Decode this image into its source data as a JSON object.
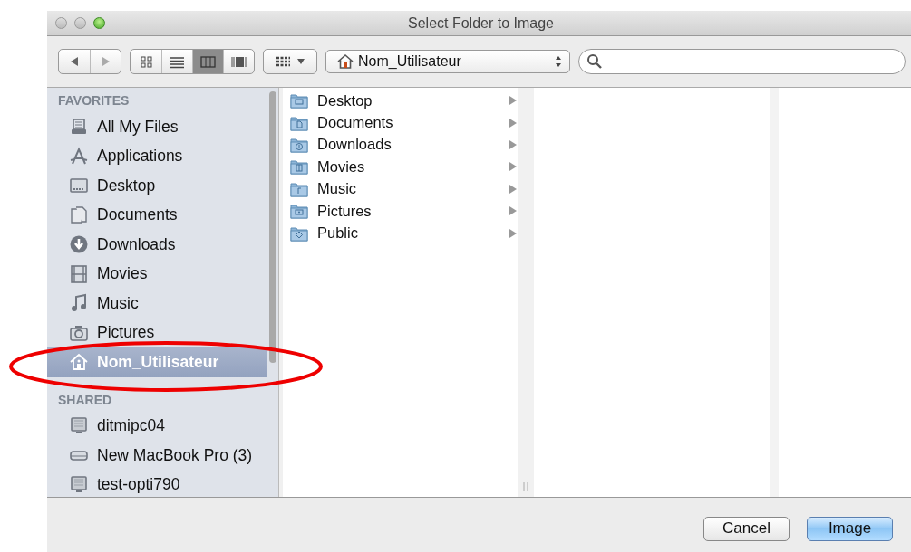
{
  "window": {
    "title": "Select Folder to Image"
  },
  "toolbar": {
    "view_modes": [
      {
        "selected": false
      },
      {
        "selected": false
      },
      {
        "selected": true
      },
      {
        "selected": false
      }
    ],
    "path": "Nom_Utilisateur"
  },
  "sidebar": {
    "sections": [
      {
        "heading": "FAVORITES",
        "items": [
          {
            "label": "All My Files",
            "selected": false
          },
          {
            "label": "Applications",
            "selected": false
          },
          {
            "label": "Desktop",
            "selected": false
          },
          {
            "label": "Documents",
            "selected": false
          },
          {
            "label": "Downloads",
            "selected": false
          },
          {
            "label": "Movies",
            "selected": false
          },
          {
            "label": "Music",
            "selected": false
          },
          {
            "label": "Pictures",
            "selected": false
          },
          {
            "label": "Nom_Utilisateur",
            "selected": true
          }
        ]
      },
      {
        "heading": "SHARED",
        "items": [
          {
            "label": "ditmipc04",
            "selected": false
          },
          {
            "label": "New MacBook Pro (3)",
            "selected": false
          },
          {
            "label": "test-opti790",
            "selected": false
          }
        ]
      }
    ]
  },
  "column_1": {
    "items": [
      {
        "label": "Desktop"
      },
      {
        "label": "Documents"
      },
      {
        "label": "Downloads"
      },
      {
        "label": "Movies"
      },
      {
        "label": "Music"
      },
      {
        "label": "Pictures"
      },
      {
        "label": "Public"
      }
    ]
  },
  "buttons": [
    {
      "label": "Cancel",
      "kind": "normal"
    },
    {
      "label": "Image",
      "kind": "default"
    }
  ],
  "annotation": {
    "kind": "ellipse",
    "color": "#ee0000"
  }
}
